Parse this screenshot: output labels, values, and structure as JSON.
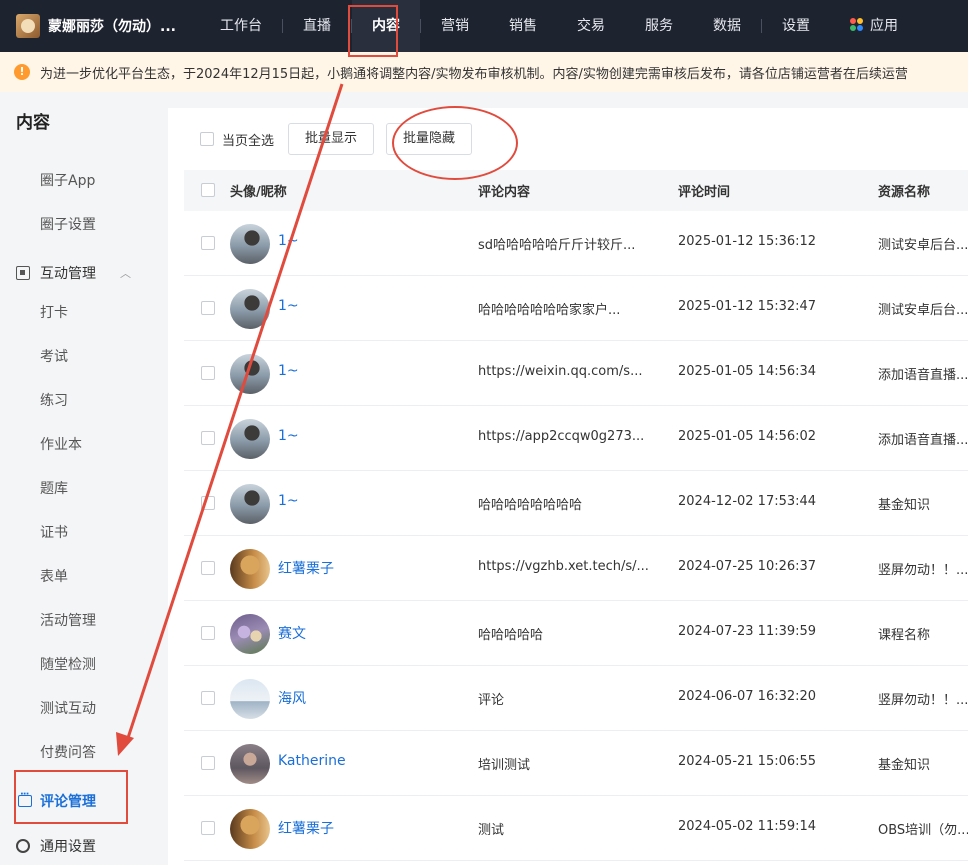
{
  "header": {
    "shop_name": "蒙娜丽莎（勿动）...",
    "nav": [
      "工作台",
      "直播",
      "内容",
      "营销",
      "销售",
      "交易",
      "服务",
      "数据",
      "设置",
      "应用"
    ],
    "active_nav": "内容"
  },
  "notice": {
    "text": "为进一步优化平台生态，于2024年12月15日起，小鹅通将调整内容/实物发布审核机制。内容/实物创建完需审核后发布，请各位店铺运营者在后续运营"
  },
  "sidebar": {
    "title": "内容",
    "top_items": [
      "圈子App",
      "圈子设置"
    ],
    "group": {
      "label": "互动管理",
      "expanded": true
    },
    "sub_items": [
      "打卡",
      "考试",
      "练习",
      "作业本",
      "题库",
      "证书",
      "表单",
      "活动管理",
      "随堂检测",
      "测试互动",
      "付费问答"
    ],
    "active_item": "评论管理",
    "settings_item": "通用设置"
  },
  "toolbar": {
    "select_all_label": "当页全选",
    "batch_show": "批量显示",
    "batch_hide": "批量隐藏"
  },
  "table": {
    "headers": [
      "头像/昵称",
      "评论内容",
      "评论时间",
      "资源名称"
    ],
    "rows": [
      {
        "avatar": "av-1",
        "nick": "1~",
        "content": "sd哈哈哈哈哈斤斤计较斤...",
        "time": "2025-01-12 15:36:12",
        "resource": "测试安卓后台..."
      },
      {
        "avatar": "av-1",
        "nick": "1~",
        "content": "哈哈哈哈哈哈哈家家户...",
        "time": "2025-01-12 15:32:47",
        "resource": "测试安卓后台..."
      },
      {
        "avatar": "av-1",
        "nick": "1~",
        "content": "https://weixin.qq.com/s...",
        "time": "2025-01-05 14:56:34",
        "resource": "添加语音直播..."
      },
      {
        "avatar": "av-1",
        "nick": "1~",
        "content": "https://app2ccqw0g273...",
        "time": "2025-01-05 14:56:02",
        "resource": "添加语音直播..."
      },
      {
        "avatar": "av-1",
        "nick": "1~",
        "content": "哈哈哈哈哈哈哈哈",
        "time": "2024-12-02 17:53:44",
        "resource": "基金知识"
      },
      {
        "avatar": "av-2",
        "nick": "红薯栗子",
        "content": "https://vgzhb.xet.tech/s/...",
        "time": "2024-07-25 10:26:37",
        "resource": "竖屏勿动！！..."
      },
      {
        "avatar": "av-3",
        "nick": "赛文",
        "content": "哈哈哈哈哈",
        "time": "2024-07-23 11:39:59",
        "resource": "课程名称"
      },
      {
        "avatar": "av-4",
        "nick": "海风",
        "content": "评论",
        "time": "2024-06-07 16:32:20",
        "resource": "竖屏勿动！！..."
      },
      {
        "avatar": "av-5",
        "nick": "Katherine",
        "content": "培训测试",
        "time": "2024-05-21 15:06:55",
        "resource": "基金知识"
      },
      {
        "avatar": "av-2",
        "nick": "红薯栗子",
        "content": "测试",
        "time": "2024-05-02 11:59:14",
        "resource": "OBS培训（勿..."
      }
    ]
  },
  "colors": {
    "accent": "#1a6fd8",
    "annotation": "#e04b3d",
    "topbar": "#1e2330"
  }
}
